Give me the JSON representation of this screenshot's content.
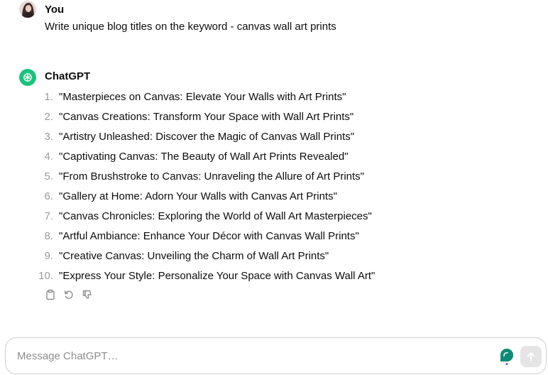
{
  "user_message": {
    "author": "You",
    "text": "Write unique blog titles on the keyword - canvas wall art prints"
  },
  "assistant_message": {
    "author": "ChatGPT",
    "items": [
      {
        "number": "1.",
        "text": "\"Masterpieces on Canvas: Elevate Your Walls with Art Prints\""
      },
      {
        "number": "2.",
        "text": "\"Canvas Creations: Transform Your Space with Wall Art Prints\""
      },
      {
        "number": "3.",
        "text": "\"Artistry Unleashed: Discover the Magic of Canvas Wall Prints\""
      },
      {
        "number": "4.",
        "text": "\"Captivating Canvas: The Beauty of Wall Art Prints Revealed\""
      },
      {
        "number": "5.",
        "text": "\"From Brushstroke to Canvas: Unraveling the Allure of Art Prints\""
      },
      {
        "number": "6.",
        "text": "\"Gallery at Home: Adorn Your Walls with Canvas Art Prints\""
      },
      {
        "number": "7.",
        "text": "\"Canvas Chronicles: Exploring the World of Wall Art Masterpieces\""
      },
      {
        "number": "8.",
        "text": "\"Artful Ambiance: Enhance Your Décor with Canvas Wall Prints\""
      },
      {
        "number": "9.",
        "text": "\"Creative Canvas: Unveiling the Charm of Wall Art Prints\""
      },
      {
        "number": "10.",
        "text": "\"Express Your Style: Personalize Your Space with Canvas Wall Art\""
      }
    ],
    "actions": [
      "clipboard-icon",
      "regenerate-icon",
      "thumbs-down-icon"
    ]
  },
  "composer": {
    "placeholder": "Message ChatGPT…",
    "value": ""
  },
  "colors": {
    "brand_green": "#19c37d",
    "grammar_teal": "#0f8a74",
    "dot_purple": "#7c5cff"
  }
}
